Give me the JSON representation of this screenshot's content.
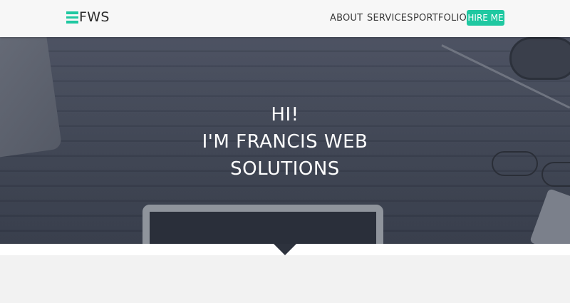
{
  "brand": {
    "logo_text": "FWS",
    "accent_color": "#1fc8a1"
  },
  "nav": {
    "about": "ABOUT",
    "services": "SERVICES",
    "portfolio": "PORTFOLIO",
    "hire": "HIRE ME"
  },
  "hero": {
    "line1": "HI!",
    "line2": "I'M FRANCIS WEB",
    "line3": "SOLUTIONS"
  }
}
